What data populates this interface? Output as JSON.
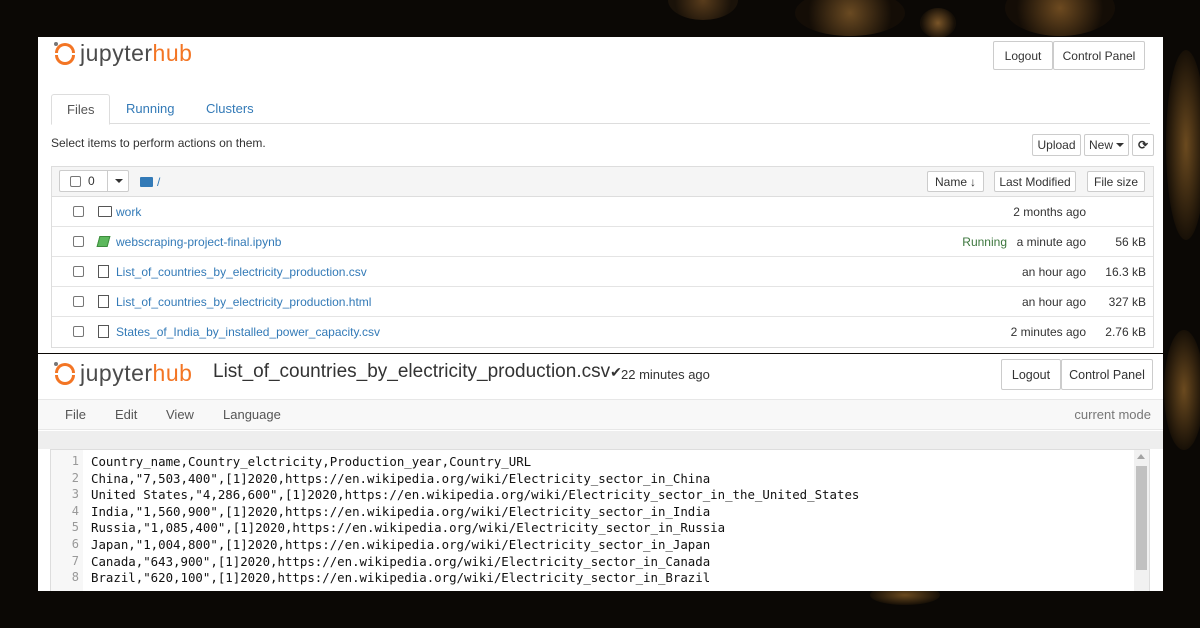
{
  "top": {
    "logo": {
      "part_a": "jupyter",
      "part_b": "hub"
    },
    "buttons": {
      "logout": "Logout",
      "control_panel": "Control Panel"
    },
    "tabs": [
      "Files",
      "Running",
      "Clusters"
    ],
    "hint": "Select items to perform actions on them.",
    "toolbar": {
      "upload": "Upload",
      "new": "New",
      "refresh_icon": "refresh-icon"
    },
    "list_header": {
      "selected_count": "0",
      "path": "/",
      "name_sort": "Name",
      "last_modified": "Last Modified",
      "file_size": "File size"
    },
    "files": [
      {
        "type": "folder",
        "name": "work",
        "status": "",
        "modified": "2 months ago",
        "size": ""
      },
      {
        "type": "notebook",
        "name": "webscraping-project-final.ipynb",
        "status": "Running",
        "modified": "a minute ago",
        "size": "56 kB"
      },
      {
        "type": "file",
        "name": "List_of_countries_by_electricity_production.csv",
        "status": "",
        "modified": "an hour ago",
        "size": "16.3 kB"
      },
      {
        "type": "file",
        "name": "List_of_countries_by_electricity_production.html",
        "status": "",
        "modified": "an hour ago",
        "size": "327 kB"
      },
      {
        "type": "file",
        "name": "States_of_India_by_installed_power_capacity.csv",
        "status": "",
        "modified": "2 minutes ago",
        "size": "2.76 kB"
      }
    ]
  },
  "editor": {
    "logo": {
      "part_a": "jupyter",
      "part_b": "hub"
    },
    "filename": "List_of_countries_by_electricity_production.csv",
    "checkmark": "✔",
    "saved_time": "22 minutes ago",
    "buttons": {
      "logout": "Logout",
      "control_panel": "Control Panel"
    },
    "menus": [
      "File",
      "Edit",
      "View",
      "Language"
    ],
    "mode": "current mode",
    "lines": [
      {
        "n": "1",
        "text": "Country_name,Country_elctricity,Production_year,Country_URL"
      },
      {
        "n": "2",
        "text": "China,\"7,503,400\",[1]2020,https://en.wikipedia.org/wiki/Electricity_sector_in_China"
      },
      {
        "n": "3",
        "text": "United States,\"4,286,600\",[1]2020,https://en.wikipedia.org/wiki/Electricity_sector_in_the_United_States"
      },
      {
        "n": "4",
        "text": "India,\"1,560,900\",[1]2020,https://en.wikipedia.org/wiki/Electricity_sector_in_India"
      },
      {
        "n": "5",
        "text": "Russia,\"1,085,400\",[1]2020,https://en.wikipedia.org/wiki/Electricity_sector_in_Russia"
      },
      {
        "n": "6",
        "text": "Japan,\"1,004,800\",[1]2020,https://en.wikipedia.org/wiki/Electricity_sector_in_Japan"
      },
      {
        "n": "7",
        "text": "Canada,\"643,900\",[1]2020,https://en.wikipedia.org/wiki/Electricity_sector_in_Canada"
      },
      {
        "n": "8",
        "text": "Brazil,\"620,100\",[1]2020,https://en.wikipedia.org/wiki/Electricity_sector_in_Brazil"
      }
    ]
  },
  "colors": {
    "accent": "#f37524",
    "link": "#337ab7",
    "running": "#3c763d"
  }
}
